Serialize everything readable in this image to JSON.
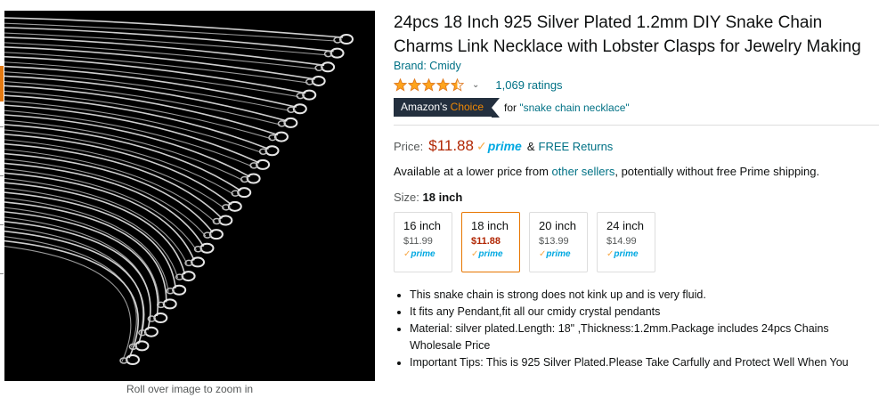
{
  "gallery": {
    "zoom_hint": "Roll over image to zoom in"
  },
  "product": {
    "title": "24pcs 18 Inch 925 Silver Plated 1.2mm DIY Snake Chain Charms Link Necklace with Lobster Clasps for Jewelry Making",
    "brand": "Brand: Cmidy",
    "rating_stars": 4.5,
    "ratings_count": "1,069 ratings",
    "badge_prefix": "Amazon's",
    "badge_word": "Choice",
    "badge_for": "for",
    "badge_query": "\"snake chain necklace\""
  },
  "pricing": {
    "label": "Price:",
    "value": "$11.88",
    "prime": "prime",
    "and": "&",
    "free_returns": "FREE Returns",
    "lower_price_prefix": "Available at a lower price from",
    "lower_price_link": "other sellers",
    "lower_price_suffix": ", potentially without free Prime shipping."
  },
  "size": {
    "label": "Size:",
    "selected": "18 inch",
    "options": [
      {
        "name": "16 inch",
        "price": "$11.99",
        "prime": "prime"
      },
      {
        "name": "18 inch",
        "price": "$11.88",
        "prime": "prime"
      },
      {
        "name": "20 inch",
        "price": "$13.99",
        "prime": "prime"
      },
      {
        "name": "24 inch",
        "price": "$14.99",
        "prime": "prime"
      }
    ]
  },
  "bullets": [
    "This snake chain is strong does not kink up and is very fluid.",
    "It fits any Pendant,fit all our cmidy crystal pendants",
    "Material: silver plated.Length: 18\" ,Thickness:1.2mm.Package includes 24pcs Chains Wholesale Price",
    "Important Tips: This is 925 Silver Plated.Please Take Carfully and Protect Well When You"
  ],
  "colors": {
    "link": "#007185",
    "price": "#b12704",
    "prime": "#00a8e1",
    "star": "#ffa41c",
    "badge_bg": "#232f3e",
    "badge_accent": "#f08804",
    "selected_border": "#e77600"
  }
}
